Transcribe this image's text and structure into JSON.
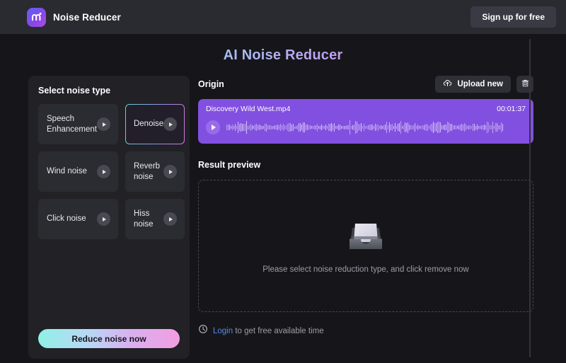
{
  "header": {
    "brand_name": "Noise Reducer",
    "logo_icon": "media-io-logo-icon",
    "signup_label": "Sign up for free"
  },
  "page": {
    "title": "AI Noise Reducer",
    "title_gradient_from": "#86e8e0",
    "title_gradient_to": "#e887d8"
  },
  "noise_panel": {
    "title": "Select noise type",
    "types": [
      {
        "label": "Speech Enhancement",
        "selected": false
      },
      {
        "label": "Denoise",
        "selected": true
      },
      {
        "label": "Wind noise",
        "selected": false
      },
      {
        "label": "Reverb noise",
        "selected": false
      },
      {
        "label": "Click noise",
        "selected": false
      },
      {
        "label": "Hiss noise",
        "selected": false
      }
    ],
    "reduce_button_label": "Reduce noise now",
    "reduce_button_gradient_from": "#8ff0e4",
    "reduce_button_gradient_to": "#f29de0"
  },
  "origin": {
    "title": "Origin",
    "upload_label": "Upload new",
    "upload_icon": "cloud-upload-icon",
    "delete_icon": "trash-icon",
    "player": {
      "file_name": "Discovery Wild West.mp4",
      "duration": "00:01:37",
      "play_icon": "play-icon",
      "background_color": "#8250e0"
    }
  },
  "result": {
    "title": "Result preview",
    "empty_icon": "empty-tray-icon",
    "empty_text": "Please select noise reduction type, and click remove now"
  },
  "footer": {
    "clock_icon": "clock-icon",
    "link_label": "Login",
    "text": " to get free available time"
  }
}
